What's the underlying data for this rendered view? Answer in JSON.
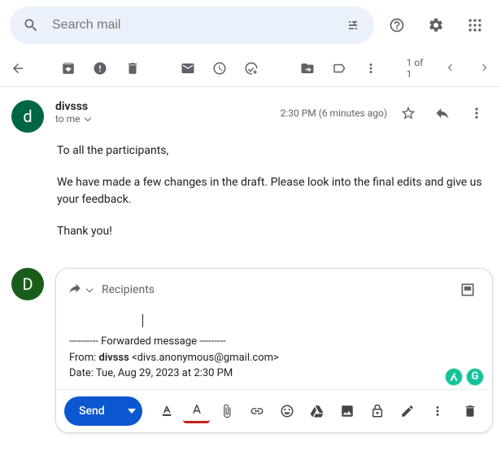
{
  "search": {
    "placeholder": "Search mail"
  },
  "toolbar": {
    "count": "1 of 1"
  },
  "email": {
    "avatar_letter": "d",
    "sender": "divsss",
    "to_line": "to me",
    "timestamp": "2:30 PM (6 minutes ago)",
    "body": {
      "p1": "To all the participants,",
      "p2": "We have made a few changes in the draft. Please look into the final edits and give us your feedback.",
      "p3": "Thank you!"
    }
  },
  "compose": {
    "avatar_letter": "D",
    "recipients_label": "Recipients",
    "fwd_separator": "---------- Forwarded message ---------",
    "fwd_from_label": "From: ",
    "fwd_from_name": "divsss",
    "fwd_from_email": " <divs.anonymous@gmail.com>",
    "fwd_date": "Date: Tue, Aug 29, 2023 at 2:30 PM",
    "send_label": "Send",
    "grammarly_letter": "G"
  }
}
